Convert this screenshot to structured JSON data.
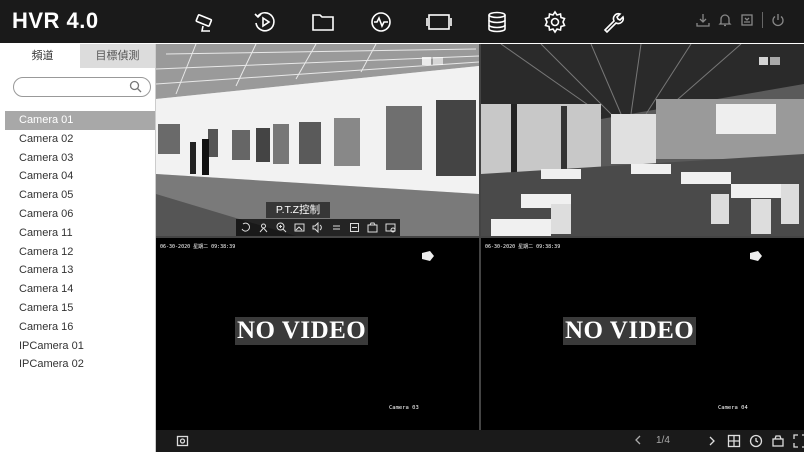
{
  "app": {
    "title": "HVR 4.0"
  },
  "toolbar": {
    "main_icons": [
      "camera-icon",
      "playback-icon",
      "folder-icon",
      "analytics-icon",
      "screen-icon",
      "storage-icon",
      "settings-icon",
      "maintenance-icon"
    ],
    "right_icons": [
      "download-icon",
      "bell-icon",
      "alarm-icon",
      "power-icon"
    ]
  },
  "sidebar": {
    "tabs": [
      {
        "label": "頻道"
      },
      {
        "label": "目標偵測"
      }
    ],
    "search": {
      "placeholder": "",
      "value": ""
    },
    "cameras": [
      {
        "label": "Camera 01",
        "selected": true
      },
      {
        "label": "Camera 02"
      },
      {
        "label": "Camera 03"
      },
      {
        "label": "Camera 04"
      },
      {
        "label": "Camera 05"
      },
      {
        "label": "Camera 06"
      },
      {
        "label": "Camera 11"
      },
      {
        "label": "Camera 12"
      },
      {
        "label": "Camera 13"
      },
      {
        "label": "Camera 14"
      },
      {
        "label": "Camera 15"
      },
      {
        "label": "Camera 16"
      },
      {
        "label": "IPCamera 01"
      },
      {
        "label": "IPCamera 02"
      }
    ]
  },
  "tiles": [
    {
      "scene": "gallery"
    },
    {
      "scene": "restaurant"
    },
    {
      "timestamp": "06-30-2020 星期二 09:38:39",
      "message": "NO VIDEO",
      "camera_name": "Camera 03"
    },
    {
      "timestamp": "06-30-2020 星期二 09:38:39",
      "message": "NO VIDEO",
      "camera_name": "Camera 04"
    }
  ],
  "ptz": {
    "label": "P.T.Z控制"
  },
  "bottombar": {
    "page": "1/4"
  },
  "colors": {
    "topbar": "#1a1a1a",
    "selected_row": "#a8a8a8",
    "tab_inactive": "#dcdcdc",
    "video_bg": "#000000"
  }
}
